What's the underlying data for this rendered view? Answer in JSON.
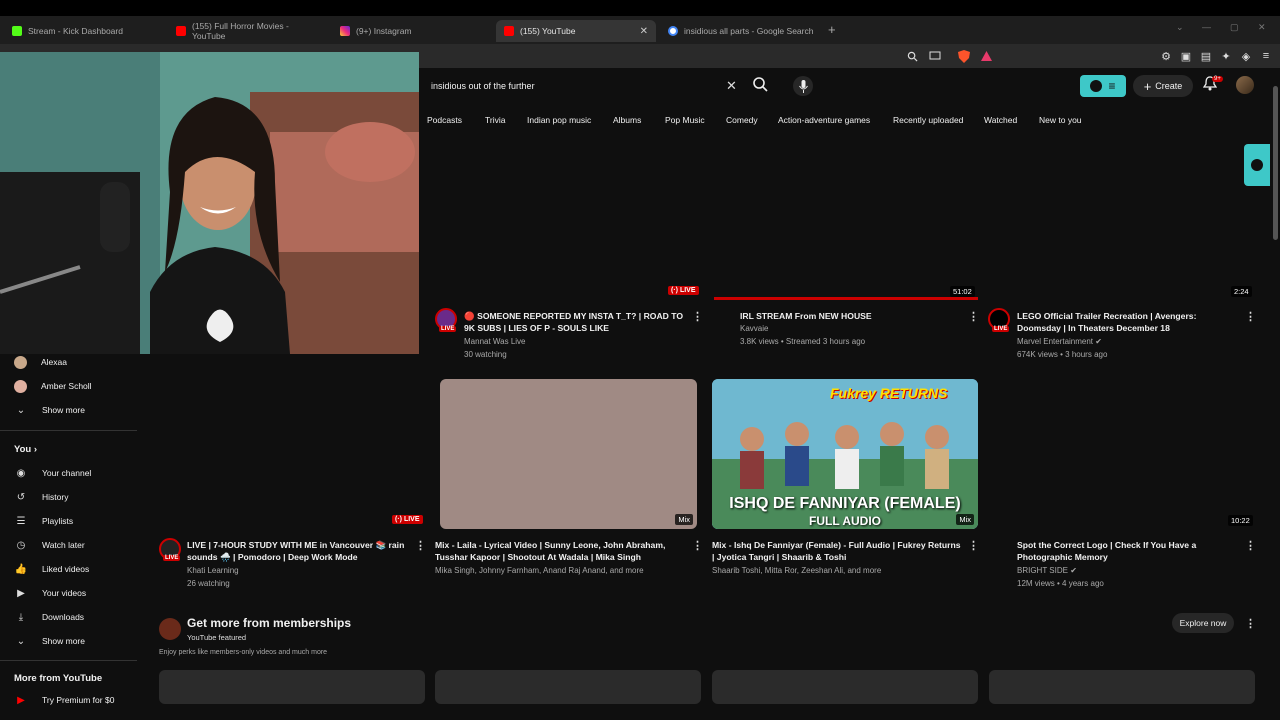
{
  "browser": {
    "tabs": [
      {
        "title": "Stream - Kick Dashboard",
        "color": "#53fc18"
      },
      {
        "title": "(155) Full Horror Movies - YouTube",
        "color": "#ff0000"
      },
      {
        "title": "(9+) Instagram",
        "color": "#e1306c"
      },
      {
        "title": "(155) YouTube",
        "color": "#ff0000",
        "close": "✕"
      },
      {
        "title": "insidious all parts - Google Search",
        "color": "#4285f4"
      }
    ],
    "new_tab": "+"
  },
  "header": {
    "search_value": "insidious out of the further",
    "create_label": "Create",
    "notif_count": "9+"
  },
  "chips": [
    "Podcasts",
    "Trivia",
    "Indian pop music",
    "Albums",
    "Pop Music",
    "Comedy",
    "Action-adventure games",
    "Recently uploaded",
    "Watched",
    "New to you"
  ],
  "sidebar": {
    "subscriptions": [
      {
        "label": "Alexaa"
      },
      {
        "label": "Amber Scholl"
      },
      {
        "label": "Show more"
      }
    ],
    "you_heading": "You",
    "you_items": [
      {
        "label": "Your channel",
        "icon": "channel-icon"
      },
      {
        "label": "History",
        "icon": "history-icon"
      },
      {
        "label": "Playlists",
        "icon": "playlists-icon"
      },
      {
        "label": "Watch later",
        "icon": "clock-icon"
      },
      {
        "label": "Liked videos",
        "icon": "thumbs-up-icon"
      },
      {
        "label": "Your videos",
        "icon": "video-icon"
      },
      {
        "label": "Downloads",
        "icon": "download-icon"
      },
      {
        "label": "Show more",
        "icon": "chevron-down-icon"
      }
    ],
    "more_heading": "More from YouTube",
    "premium_label": "Try Premium for $0"
  },
  "videos_row1": [
    {
      "title": "🔴 SOMEONE REPORTED MY INSTA T_T? | ROAD TO 9K SUBS | LIES OF P - SOULS LIKE",
      "channel": "Mannat Was Live",
      "meta": "30 watching",
      "badge": "LIVE",
      "thumb_badge": "(·) LIVE"
    },
    {
      "title": "IRL STREAM From NEW HOUSE",
      "channel": "Kavvaie",
      "meta": "3.8K views • Streamed 3 hours ago",
      "duration": "51:02"
    },
    {
      "title": "LEGO Official Trailer Recreation | Avengers: Doomsday | In Theaters December 18",
      "channel": "Marvel Entertainment ✔",
      "meta": "674K views • 3 hours ago",
      "badge": "LIVE",
      "duration": "2:24"
    }
  ],
  "videos_row2": [
    {
      "title": "LIVE | 7-HOUR STUDY WITH ME in Vancouver 📚 rain sounds 🌧️ | Pomodoro | Deep Work Mode",
      "channel": "Khati Learning",
      "meta": "26 watching",
      "badge": "LIVE",
      "thumb_badge": "(·) LIVE"
    },
    {
      "title": "Mix - Laila - Lyrical Video | Sunny Leone, John Abraham, Tusshar Kapoor | Shootout At Wadala | Mika Singh",
      "channel": "Mika Singh, Johnny Farnham, Anand Raj Anand, and more",
      "thumb_badge": "Mix"
    },
    {
      "title": "Mix - Ishq De Fanniyar (Female) - Full Audio | Fukrey Returns | Jyotica Tangri | Shaarib & Toshi",
      "channel": "Shaarib Toshi, Mitta Ror, Zeeshan Ali, and more",
      "thumb_badge": "Mix",
      "thumb_text_top": "ISHQ DE FANNIYAR (FEMALE)",
      "thumb_text_bottom": "FULL AUDIO",
      "thumb_logo": "Fukrey RETURNS"
    },
    {
      "title": "Spot the Correct Logo | Check If You Have a Photographic Memory",
      "channel": "BRIGHT SIDE ✔",
      "meta": "12M views • 4 years ago",
      "duration": "10:22"
    }
  ],
  "memberships": {
    "title": "Get more from memberships",
    "subtitle": "YouTube featured",
    "description": "Enjoy perks like members-only videos and much more",
    "explore_label": "Explore now"
  },
  "colors": {
    "accent_teal": "#3ec8c8",
    "live_red": "#cc0000",
    "bg": "#0f0f0f"
  }
}
